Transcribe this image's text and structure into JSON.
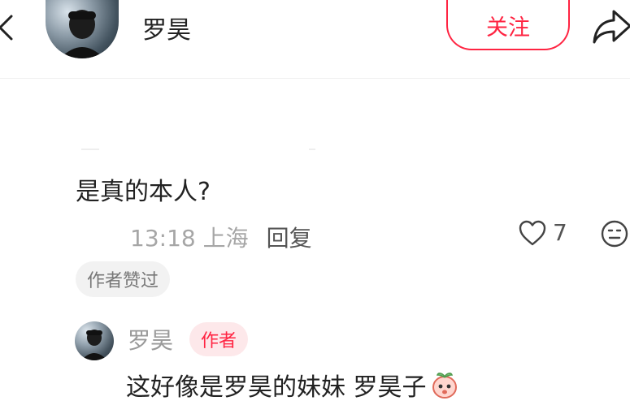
{
  "header": {
    "name": "罗昊",
    "follow_label": "关注"
  },
  "comment": {
    "text": "是真的本人?",
    "time_location": "13:18 上海",
    "reply_label": "回复",
    "likes": "7",
    "author_liked_badge": "作者赞过"
  },
  "reply": {
    "name": "罗昊",
    "author_tag": "作者",
    "text": "这好像是罗昊的妹妹 罗昊子"
  },
  "colors": {
    "accent": "#ff2442",
    "author_tag_bg": "#fde8ea"
  },
  "icons": [
    "back-icon",
    "share-icon",
    "heart-icon",
    "emoji-icon",
    "peach-emoji-icon"
  ]
}
